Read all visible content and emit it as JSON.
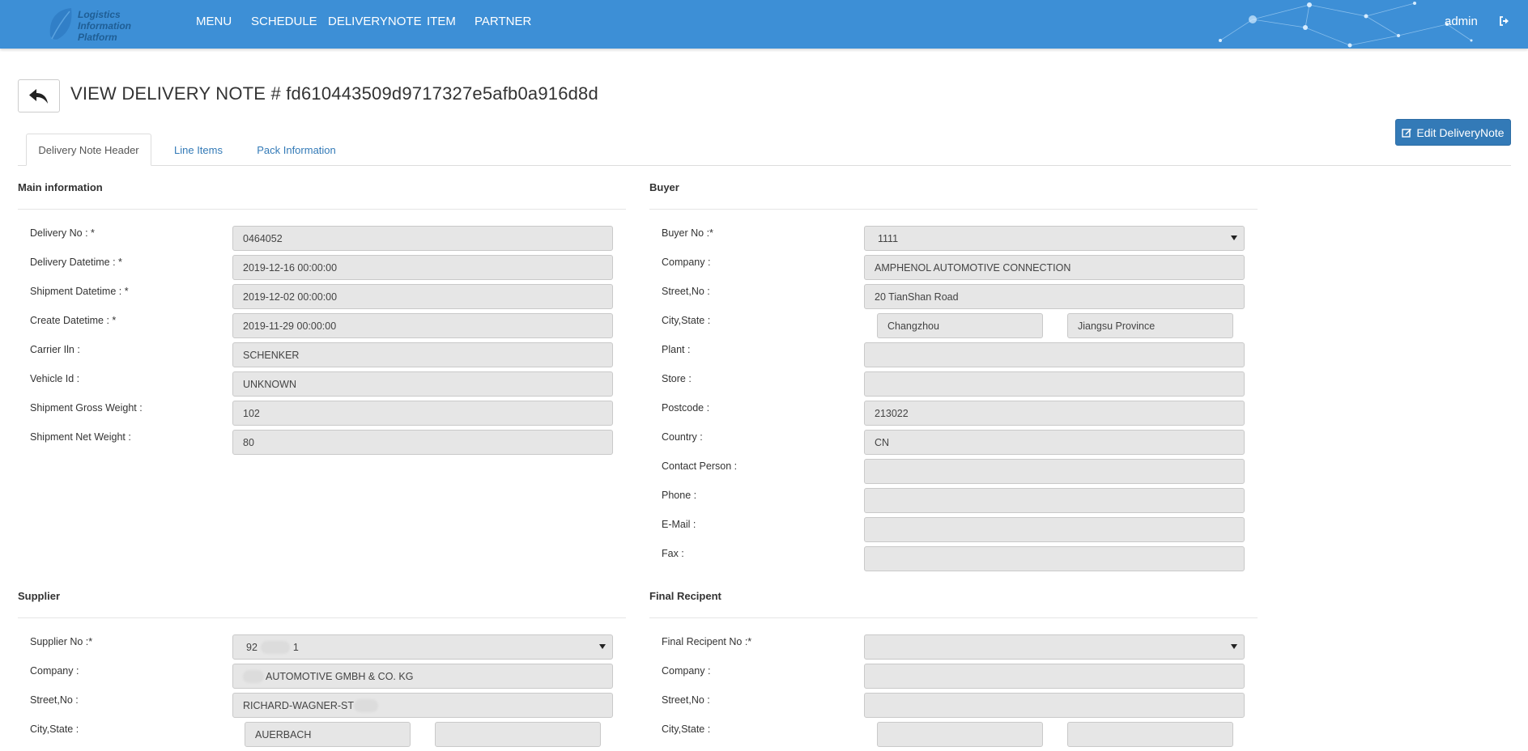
{
  "app": {
    "logo_lines": [
      "Logistics",
      "Information",
      "Platform"
    ],
    "nav": [
      "MENU",
      "SCHEDULE",
      "DELIVERYNOTE",
      "ITEM",
      "PARTNER"
    ],
    "user": "admin"
  },
  "page": {
    "title": "VIEW DELIVERY NOTE # fd610443509d9717327e5afb0a916d8d",
    "edit_label": "Edit DeliveryNote"
  },
  "tabs": [
    "Delivery Note Header",
    "Line Items",
    "Pack Information"
  ],
  "main": {
    "title": "Main information",
    "fields": [
      {
        "label": "Delivery No : *",
        "value": "0464052"
      },
      {
        "label": "Delivery Datetime : *",
        "value": "2019-12-16 00:00:00"
      },
      {
        "label": "Shipment Datetime : *",
        "value": "2019-12-02 00:00:00"
      },
      {
        "label": "Create Datetime : *",
        "value": "2019-11-29 00:00:00"
      },
      {
        "label": "Carrier Iln :",
        "value": "SCHENKER"
      },
      {
        "label": "Vehicle Id :",
        "value": "UNKNOWN"
      },
      {
        "label": "Shipment Gross Weight :",
        "value": "102"
      },
      {
        "label": "Shipment Net Weight :",
        "value": "80"
      }
    ]
  },
  "buyer": {
    "title": "Buyer",
    "buyer_no_label": "Buyer No :*",
    "buyer_no": "1111",
    "company_label": "Company :",
    "company": "AMPHENOL AUTOMOTIVE CONNECTION",
    "street_label": "Street,No :",
    "street": "20 TianShan Road",
    "city_label": "City,State :",
    "city": "Changzhou",
    "state": "Jiangsu Province",
    "plant_label": "Plant :",
    "plant": "",
    "store_label": "Store :",
    "store": "",
    "postcode_label": "Postcode :",
    "postcode": "213022",
    "country_label": "Country :",
    "country": "CN",
    "contact_label": "Contact Person :",
    "contact": "",
    "phone_label": "Phone :",
    "phone": "",
    "email_label": "E-Mail :",
    "email": "",
    "fax_label": "Fax :",
    "fax": ""
  },
  "supplier": {
    "title": "Supplier",
    "no_label": "Supplier No :*",
    "no_prefix": "92",
    "no_suffix": "1",
    "company_label": "Company :",
    "company": "AUTOMOTIVE GMBH & CO. KG",
    "street_label": "Street,No :",
    "street": "RICHARD-WAGNER-ST",
    "city_label": "City,State :",
    "city": "AUERBACH",
    "state": ""
  },
  "recipient": {
    "title": "Final Recipent",
    "no_label": "Final Recipent No :*",
    "no": "",
    "company_label": "Company :",
    "company": "",
    "street_label": "Street,No :",
    "street": "",
    "city_label": "City,State :",
    "city": "",
    "state": ""
  }
}
